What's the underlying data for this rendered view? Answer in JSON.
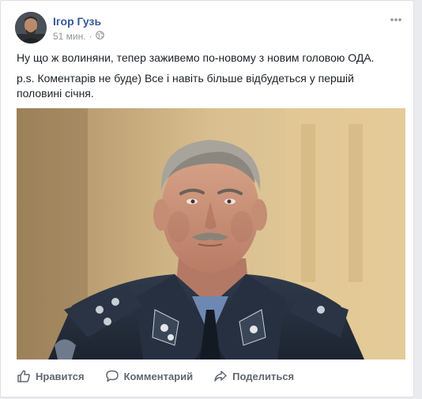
{
  "post": {
    "author": "Ігор Гузь",
    "time": "51 мин.",
    "audience_icon": "globe-icon",
    "text_line_1": "Ну що ж волиняни, тепер заживемо по-новому з новим головою ОДА.",
    "text_line_2": "p.s. Коментарів не буде) Все і навіть більше відбудеться у першій половині січня.",
    "photo_subject": "portrait-photo"
  },
  "actions": {
    "like_label": "Нравится",
    "like_icon": "thumbs-up-icon",
    "comment_label": "Комментарий",
    "comment_icon": "speech-bubble-icon",
    "share_label": "Поделиться",
    "share_icon": "share-arrow-icon"
  },
  "colors": {
    "link": "#365899",
    "text": "#1d2129",
    "meta": "#90949c",
    "action": "#606770",
    "background": "#e9ebee"
  }
}
